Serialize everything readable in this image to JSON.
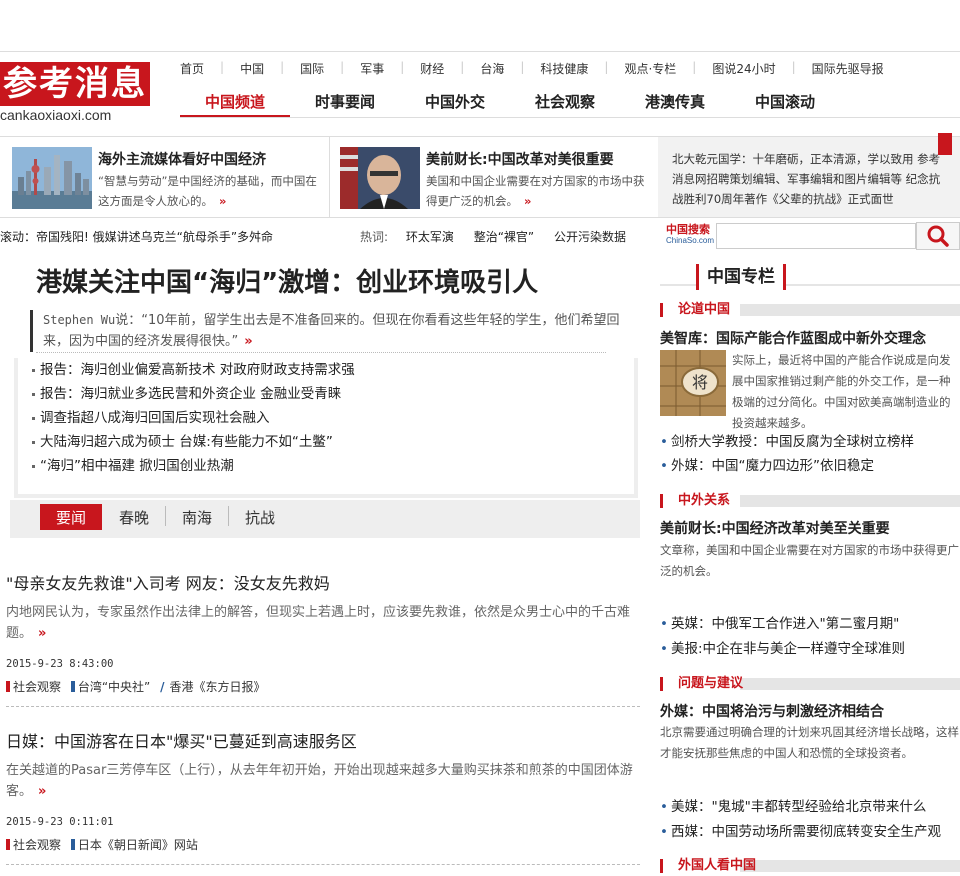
{
  "logo": {
    "seal_text": "参考消息",
    "domain": "cankaoxiaoxi.com"
  },
  "nav_top": [
    "首页",
    "中国",
    "国际",
    "军事",
    "财经",
    "台海",
    "科技健康",
    "观点·专栏",
    "图说24小时",
    "国际先驱导报"
  ],
  "nav_main": [
    "中国频道",
    "时事要闻",
    "中国外交",
    "社会观察",
    "港澳传真",
    "中国滚动"
  ],
  "features": [
    {
      "title": "海外主流媒体看好中国经济",
      "desc": "“智慧与劳动”是中国经济的基础，而中国在这方面是令人放心的。",
      "more": "»"
    },
    {
      "title": "美前财长:中国改革对美很重要",
      "desc": "美国和中国企业需要在对方国家的市场中获得更广泛的机会。",
      "more": "»"
    }
  ],
  "notice": "北大乾元国学：十年磨砺，正本清源，学以致用 参考消息网招聘策划编辑、军事编辑和图片编辑等 纪念抗战胜利70周年著作《父辈的抗战》正式面世",
  "ticker": "滚动：帝国残阳! 俄媒讲述乌克兰“航母杀手”多舛命",
  "hot": {
    "label": "热词:",
    "words": [
      "环太军演",
      "整治“裸官”",
      "公开污染数据"
    ]
  },
  "search": {
    "brand_top": "中国搜索",
    "brand_bottom": "ChinaSo.com"
  },
  "headline": "港媒关注中国“海归”激增：创业环境吸引人",
  "quote": {
    "speaker": "Stephen Wu",
    "text": "说：“10年前，留学生出去是不准备回来的。但现在你看看这些年轻的学生，他们希望回来，因为中国的经济发展得很快。”",
    "more": "»"
  },
  "related": [
    "报告：海归创业偏爱高新技术 对政府财政支持需求强",
    "报告：海归就业多选民营和外资企业 金融业受青睐",
    "调查指超八成海归回国后实现社会融入",
    "大陆海归超六成为硕士 台媒:有些能力不如“土鳖”",
    "“海归”相中福建 掀归国创业热潮"
  ],
  "tabs": [
    "要闻",
    "春晚",
    "南海",
    "抗战"
  ],
  "news": [
    {
      "title": "\"母亲女友先救谁\"入司考 网友：没女友先救妈",
      "desc": "内地网民认为，专家虽然作出法律上的解答，但现实上若遇上时，应该要先救谁，依然是众男士心中的千古难题。",
      "more": "»",
      "date": "2015-9-23 8:43:00",
      "tags": [
        "社会观察",
        "台湾“中央社”",
        "香港《东方日报》"
      ]
    },
    {
      "title": "日媒：中国游客在日本\"爆买\"已蔓延到高速服务区",
      "desc": "在关越道的Pasar三芳停车区（上行），从去年年初开始，开始出现越来越多大量购买抹茶和煎茶的中国团体游客。",
      "more": "»",
      "date": "2015-9-23 0:11:01",
      "tags": [
        "社会观察",
        "日本《朝日新闻》网站"
      ]
    }
  ],
  "right": {
    "column_title": "中国专栏",
    "sections": [
      {
        "name": "论道中国",
        "headline": "美智库：国际产能合作蓝图成中新外交理念",
        "desc": "实际上，最近将中国的产能合作说成是向发展中国家推销过剩产能的外交工作，是一种极端的过分简化。中国对欧美高端制造业的投资越来越多。",
        "items": [
          "剑桥大学教授：中国反腐为全球树立榜样",
          "外媒：中国“魔力四边形”依旧稳定"
        ]
      },
      {
        "name": "中外关系",
        "headline": "美前财长:中国经济改革对美至关重要",
        "desc": "文章称，美国和中国企业需要在对方国家的市场中获得更广泛的机会。",
        "items": [
          "英媒：中俄军工合作进入\"第二蜜月期\"",
          "美报:中企在非与美企一样遵守全球准则"
        ]
      },
      {
        "name": "问题与建议",
        "headline": "外媒：中国将治污与刺激经济相结合",
        "desc": "北京需要通过明确合理的计划来巩固其经济增长战略，这样才能安抚那些焦虑的中国人和恐慌的全球投资者。",
        "items": [
          "美媒：\"鬼城\"丰都转型经验给北京带来什么",
          "西媒：中国劳动场所需要彻底转变安全生产观"
        ]
      },
      {
        "name": "外国人看中国"
      }
    ],
    "chess_glyph": "将"
  },
  "colors": {
    "brand_red": "#c8161d",
    "link_blue": "#2a5d9a"
  }
}
